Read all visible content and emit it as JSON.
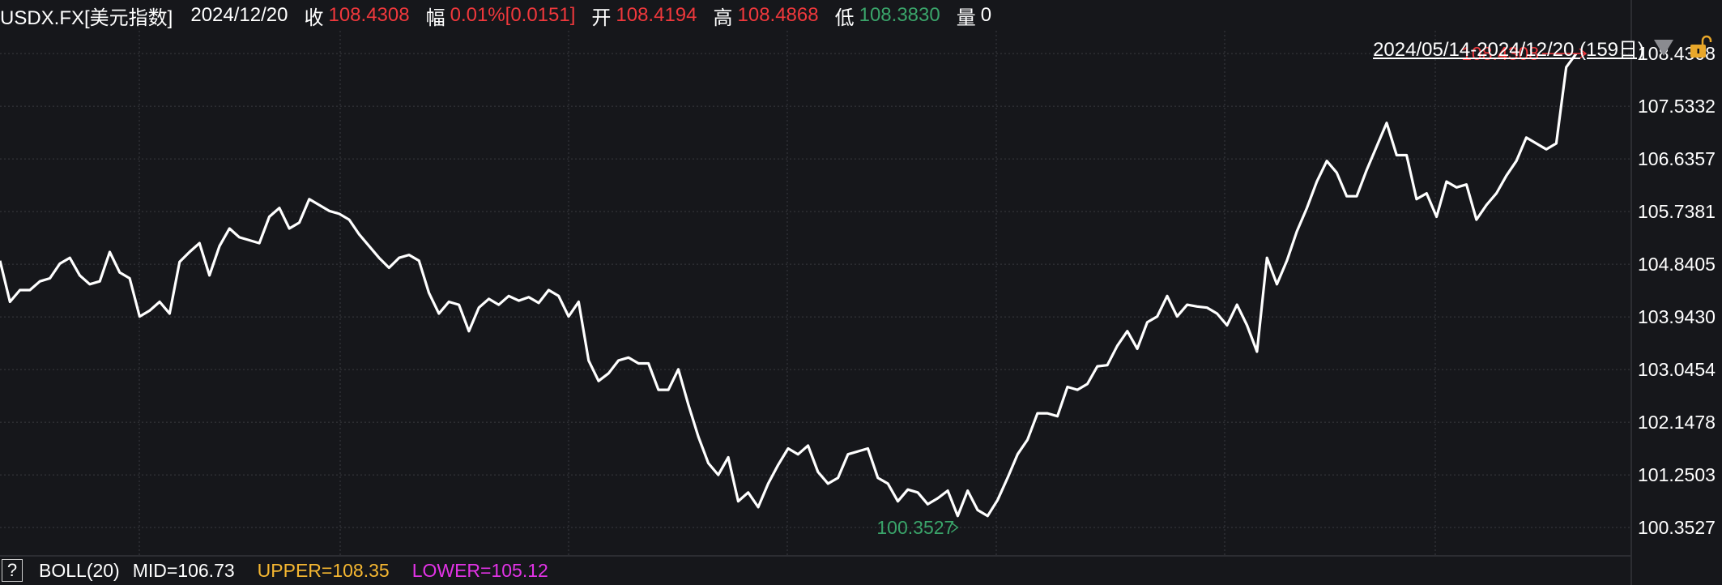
{
  "header": {
    "symbol": "USDX.FX[美元指数]",
    "date": "2024/12/20",
    "close_label": "收",
    "close_value": "108.4308",
    "change_label": "幅",
    "change_value": "0.01%[0.0151]",
    "open_label": "开",
    "open_value": "108.4194",
    "high_label": "高",
    "high_value": "108.4868",
    "low_label": "低",
    "low_value": "108.3830",
    "volume_label": "量",
    "volume_value": "0"
  },
  "range": {
    "label": "2024/05/14-2024/12/20 (159日)",
    "dropdown_icon": "triangle-down-icon",
    "lock_icon": "unlock-icon"
  },
  "indicator": {
    "help_label": "?",
    "name": "BOLL(20)",
    "mid": "MID=106.73",
    "upper": "UPPER=108.35",
    "lower": "LOWER=105.12"
  },
  "colors": {
    "background": "#16171b",
    "line": "#ffffff",
    "grid": "#3a3b40",
    "up": "#f0383c",
    "down": "#3aa46a",
    "upper_band": "#f5b731",
    "lower_band": "#e233e6"
  },
  "chart_data": {
    "type": "line",
    "title": "",
    "xlabel": "",
    "ylabel": "",
    "x_range": [
      "2024/05/14",
      "2024/12/20"
    ],
    "ylim": [
      99.87,
      108.82
    ],
    "yticks": [
      "108.4308",
      "107.5332",
      "106.6357",
      "105.7381",
      "104.8405",
      "103.9430",
      "103.0454",
      "102.1478",
      "101.2503",
      "100.3527"
    ],
    "grid": true,
    "annotations": [
      {
        "text": "108.4308",
        "value": 108.4308,
        "kind": "max"
      },
      {
        "text": "100.3527",
        "value": 100.3527,
        "kind": "min"
      }
    ],
    "series": [
      {
        "values": [
          104.9,
          104.2,
          104.4,
          104.4,
          104.55,
          104.6,
          104.85,
          104.95,
          104.65,
          104.5,
          104.55,
          105.05,
          104.7,
          104.6,
          103.95,
          104.05,
          104.2,
          104.0,
          104.88,
          105.05,
          105.2,
          104.65,
          105.15,
          105.45,
          105.3,
          105.25,
          105.2,
          105.65,
          105.8,
          105.45,
          105.55,
          105.95,
          105.85,
          105.75,
          105.7,
          105.6,
          105.35,
          105.15,
          104.95,
          104.78,
          104.95,
          105.0,
          104.9,
          104.35,
          104.0,
          104.2,
          104.15,
          103.7,
          104.1,
          104.25,
          104.15,
          104.3,
          104.22,
          104.28,
          104.18,
          104.4,
          104.3,
          103.95,
          104.2,
          103.2,
          102.85,
          102.98,
          103.2,
          103.25,
          103.15,
          103.15,
          102.7,
          102.7,
          103.05,
          102.45,
          101.9,
          101.45,
          101.25,
          101.55,
          100.8,
          100.95,
          100.7,
          101.1,
          101.42,
          101.7,
          101.6,
          101.75,
          101.3,
          101.1,
          101.2,
          101.6,
          101.65,
          101.7,
          101.2,
          101.1,
          100.8,
          101.0,
          100.95,
          100.75,
          100.85,
          100.98,
          100.55,
          100.98,
          100.65,
          100.55,
          100.82,
          101.2,
          101.6,
          101.85,
          102.3,
          102.3,
          102.25,
          102.75,
          102.7,
          102.8,
          103.1,
          103.12,
          103.45,
          103.7,
          103.4,
          103.85,
          103.95,
          104.3,
          103.95,
          104.15,
          104.12,
          104.1,
          104.0,
          103.8,
          104.15,
          103.8,
          103.35,
          104.95,
          104.5,
          104.9,
          105.4,
          105.8,
          106.25,
          106.6,
          106.4,
          106.0,
          106.0,
          106.45,
          106.85,
          107.25,
          106.7,
          106.7,
          105.95,
          106.05,
          105.65,
          106.25,
          106.15,
          106.2,
          105.6,
          105.85,
          106.05,
          106.35,
          106.6,
          107.0,
          106.9,
          106.8,
          106.9,
          108.2,
          108.43
        ]
      }
    ]
  }
}
